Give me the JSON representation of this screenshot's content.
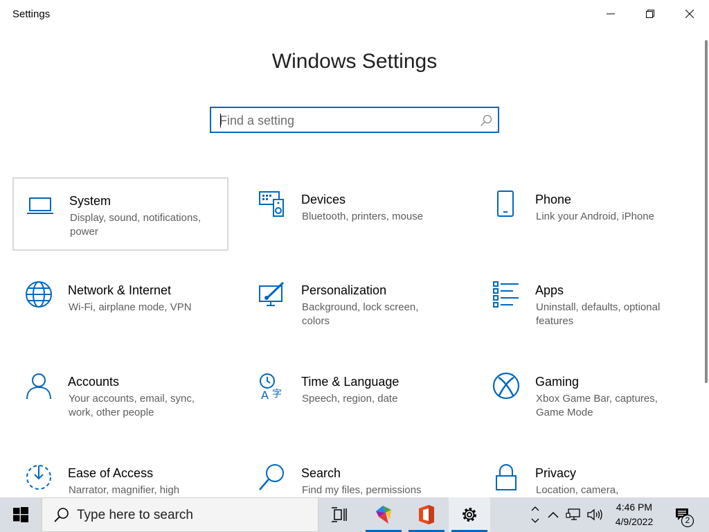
{
  "window": {
    "title": "Settings",
    "heading": "Windows Settings",
    "search_placeholder": "Find a setting"
  },
  "tiles": [
    {
      "title": "System",
      "desc": "Display, sound, notifications, power",
      "icon": "laptop-icon"
    },
    {
      "title": "Devices",
      "desc": "Bluetooth, printers, mouse",
      "icon": "devices-icon"
    },
    {
      "title": "Phone",
      "desc": "Link your Android, iPhone",
      "icon": "phone-icon"
    },
    {
      "title": "Network & Internet",
      "desc": "Wi-Fi, airplane mode, VPN",
      "icon": "globe-icon"
    },
    {
      "title": "Personalization",
      "desc": "Background, lock screen, colors",
      "icon": "paint-icon"
    },
    {
      "title": "Apps",
      "desc": "Uninstall, defaults, optional features",
      "icon": "apps-list-icon"
    },
    {
      "title": "Accounts",
      "desc": "Your accounts, email, sync, work, other people",
      "icon": "person-icon"
    },
    {
      "title": "Time & Language",
      "desc": "Speech, region, date",
      "icon": "time-language-icon"
    },
    {
      "title": "Gaming",
      "desc": "Xbox Game Bar, captures, Game Mode",
      "icon": "xbox-icon"
    },
    {
      "title": "Ease of Access",
      "desc": "Narrator, magnifier, high",
      "icon": "ease-of-access-icon"
    },
    {
      "title": "Search",
      "desc": "Find my files, permissions",
      "icon": "search-magnifier-icon"
    },
    {
      "title": "Privacy",
      "desc": "Location, camera, microphone",
      "icon": "lock-icon"
    }
  ],
  "taskbar": {
    "search_text": "Type here to search",
    "time": "4:46 PM",
    "date": "4/9/2022",
    "notification_count": "2"
  },
  "colors": {
    "accent": "#0067c0",
    "taskbar": "#d9dde4"
  }
}
